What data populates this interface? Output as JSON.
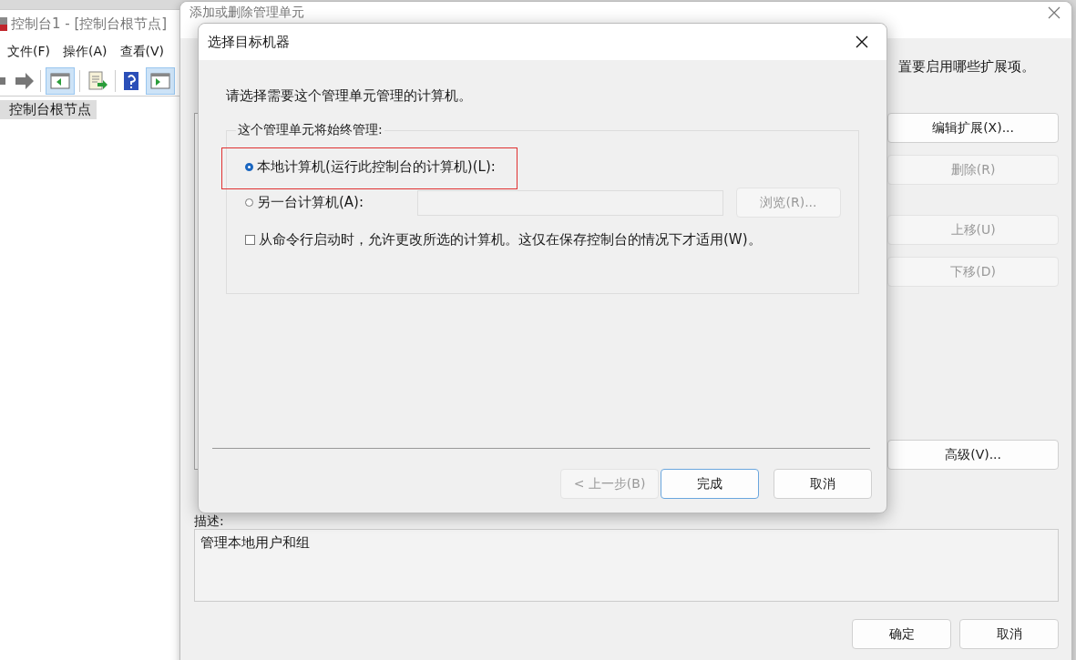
{
  "main_window": {
    "title": "控制台1 - [控制台根节点]",
    "menu": [
      "文件(F)",
      "操作(A)",
      "查看(V)"
    ],
    "tree": [
      {
        "label": "控制台根节点",
        "selected": true
      }
    ]
  },
  "snapin_dialog": {
    "title": "添加或删除管理单元",
    "intro_text": "置要启用哪些扩展项。",
    "side_buttons": [
      {
        "label": "编辑扩展(X)...",
        "disabled": false
      },
      {
        "label": "删除(R)",
        "disabled": true
      },
      {
        "label": "上移(U)",
        "disabled": true
      },
      {
        "label": "下移(D)",
        "disabled": true
      },
      {
        "label": "高级(V)...",
        "disabled": false
      }
    ],
    "description_label": "描述:",
    "description": "管理本地用户和组",
    "buttons": [
      "确定",
      "取消"
    ]
  },
  "target_dialog": {
    "title": "选择目标机器",
    "prompt": "请选择需要这个管理单元管理的计算机。",
    "group_label": "这个管理单元将始终管理:",
    "options": [
      {
        "label": "本地计算机(运行此控制台的计算机)(L):",
        "selected": true
      },
      {
        "label": "另一台计算机(A):",
        "selected": false
      }
    ],
    "computer_field": {
      "disabled": true
    },
    "browse_button": {
      "label": "浏览(R)...",
      "disabled": true
    },
    "allow_change": {
      "label": "从命令行启动时，允许更改所选的计算机。这仅在保存控制台的情况下才适用(W)。",
      "checked": false
    },
    "buttons": [
      {
        "label": "< 上一步(B)",
        "disabled": true,
        "default": false
      },
      {
        "label": "完成",
        "disabled": false,
        "default": true
      },
      {
        "label": "取消",
        "disabled": false,
        "default": false
      }
    ]
  }
}
